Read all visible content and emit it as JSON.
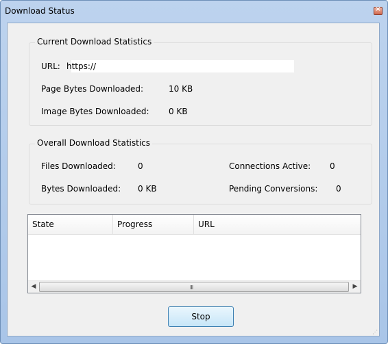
{
  "window": {
    "title": "Download Status"
  },
  "current": {
    "legend": "Current Download Statistics",
    "url_label": "URL:",
    "url_value": "https://",
    "page_bytes_label": "Page Bytes Downloaded:",
    "page_bytes_value": "10 KB",
    "image_bytes_label": "Image Bytes Downloaded:",
    "image_bytes_value": "0 KB"
  },
  "overall": {
    "legend": "Overall Download Statistics",
    "files_label": "Files Downloaded:",
    "files_value": "0",
    "bytes_label": "Bytes Downloaded:",
    "bytes_value": "0 KB",
    "connections_label": "Connections Active:",
    "connections_value": "0",
    "pending_label": "Pending Conversions:",
    "pending_value": "0"
  },
  "list": {
    "columns": [
      "State",
      "Progress",
      "URL"
    ],
    "rows": [],
    "scroll_left_icon": "arrow-left-icon",
    "scroll_right_icon": "arrow-right-icon",
    "thumb_grip": "III"
  },
  "buttons": {
    "stop_label": "Stop"
  },
  "icons": {
    "close": "close-icon",
    "size_grip": "size-grip-icon"
  },
  "colors": {
    "frame": "#a9c5e8",
    "client": "#f0f0f0",
    "close": "#d0694f",
    "button_border": "#3c7fb1"
  }
}
